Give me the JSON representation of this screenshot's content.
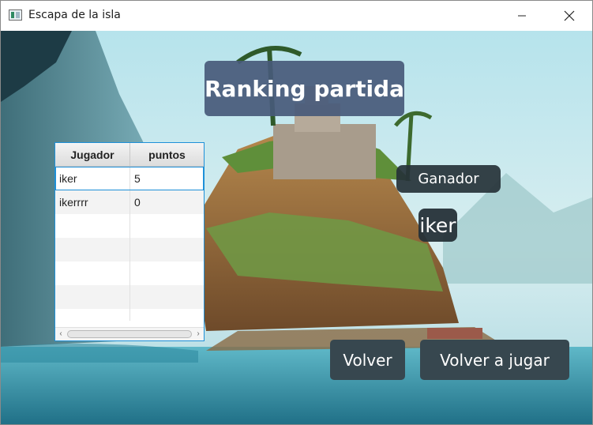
{
  "window": {
    "title": "Escapa de la isla",
    "controls": {
      "minimize": "minimize-icon",
      "maximize": "maximize-icon",
      "close": "close-icon"
    }
  },
  "heading": "Ranking partida",
  "table": {
    "columns": [
      "Jugador",
      "puntos"
    ],
    "rows": [
      {
        "jugador": "iker",
        "puntos": "5"
      },
      {
        "jugador": "ikerrrr",
        "puntos": "0"
      }
    ],
    "selected_row": 0
  },
  "winner": {
    "label": "Ganador",
    "name": "iker"
  },
  "buttons": {
    "back": "Volver",
    "play_again": "Volver a jugar"
  },
  "colors": {
    "panel": "#37474f",
    "title_panel": "#485a7a",
    "table_border": "#1e90d8"
  }
}
